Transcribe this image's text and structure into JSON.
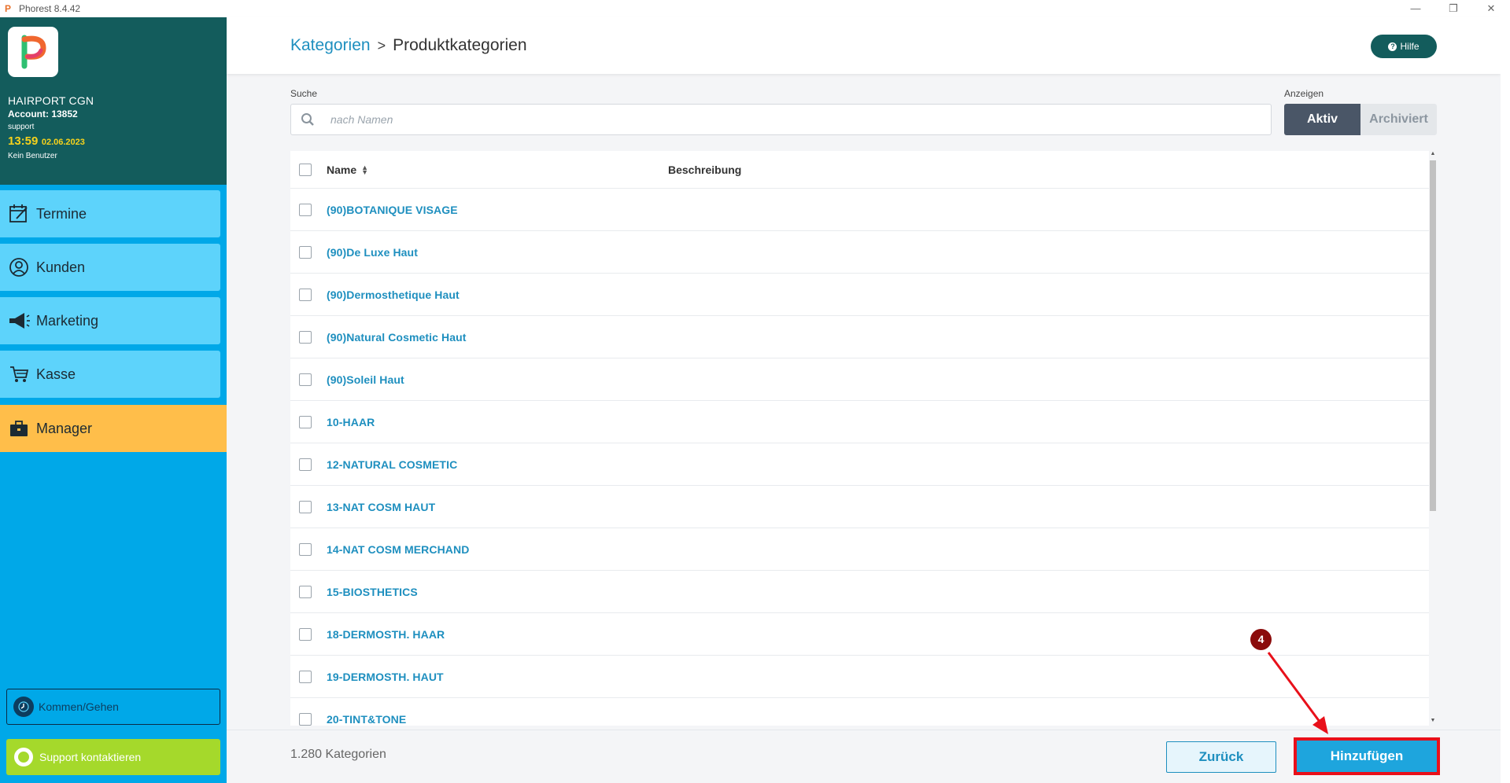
{
  "window": {
    "title": "Phorest 8.4.42",
    "controls": [
      "—",
      "❐",
      "✕"
    ]
  },
  "sidebar": {
    "salon": "HAIRPORT CGN",
    "account": "Account: 13852",
    "support_user": "support",
    "time": "13:59",
    "date": "02.06.2023",
    "user": "Kein Benutzer",
    "nav": [
      {
        "label": "Termine",
        "icon": "calendar-edit-icon"
      },
      {
        "label": "Kunden",
        "icon": "client-icon"
      },
      {
        "label": "Marketing",
        "icon": "megaphone-icon"
      },
      {
        "label": "Kasse",
        "icon": "cart-icon"
      },
      {
        "label": "Manager",
        "icon": "briefcase-icon"
      }
    ],
    "active_nav": "Manager",
    "clock_button": "Kommen/Gehen",
    "support_button": "Support kontaktieren"
  },
  "header": {
    "breadcrumb_parent": "Kategorien",
    "breadcrumb_separator": ">",
    "breadcrumb_current": "Produktkategorien",
    "help_label": "Hilfe"
  },
  "filters": {
    "search_label": "Suche",
    "search_placeholder": "nach Namen",
    "search_value": "",
    "show_label": "Anzeigen",
    "active_option": "Aktiv",
    "archived_option": "Archiviert",
    "selected": "Aktiv"
  },
  "table": {
    "columns": [
      "Name",
      "Beschreibung"
    ],
    "rows": [
      {
        "name": "(90)BOTANIQUE VISAGE",
        "description": ""
      },
      {
        "name": "(90)De Luxe Haut",
        "description": ""
      },
      {
        "name": "(90)Dermosthetique Haut",
        "description": ""
      },
      {
        "name": "(90)Natural Cosmetic Haut",
        "description": ""
      },
      {
        "name": "(90)Soleil Haut",
        "description": ""
      },
      {
        "name": "10-HAAR",
        "description": ""
      },
      {
        "name": "12-NATURAL COSMETIC",
        "description": ""
      },
      {
        "name": "13-NAT COSM HAUT",
        "description": ""
      },
      {
        "name": "14-NAT COSM MERCHAND",
        "description": ""
      },
      {
        "name": "15-BIOSTHETICS",
        "description": ""
      },
      {
        "name": "18-DERMOSTH. HAAR",
        "description": ""
      },
      {
        "name": "19-DERMOSTH. HAUT",
        "description": ""
      },
      {
        "name": "20-TINT&TONE",
        "description": ""
      }
    ]
  },
  "footer": {
    "count": "1.280 Kategorien",
    "back_label": "Zurück",
    "add_label": "Hinzufügen"
  },
  "annotation": {
    "step": "4",
    "color": "#e8101a"
  },
  "colors": {
    "sidebar_top": "#135c5c",
    "sidebar": "#00a8e8",
    "nav_item": "#5dd3fb",
    "nav_active": "#ffbe4a",
    "link": "#1e8fbf",
    "primary_button": "#1ea5dd"
  }
}
